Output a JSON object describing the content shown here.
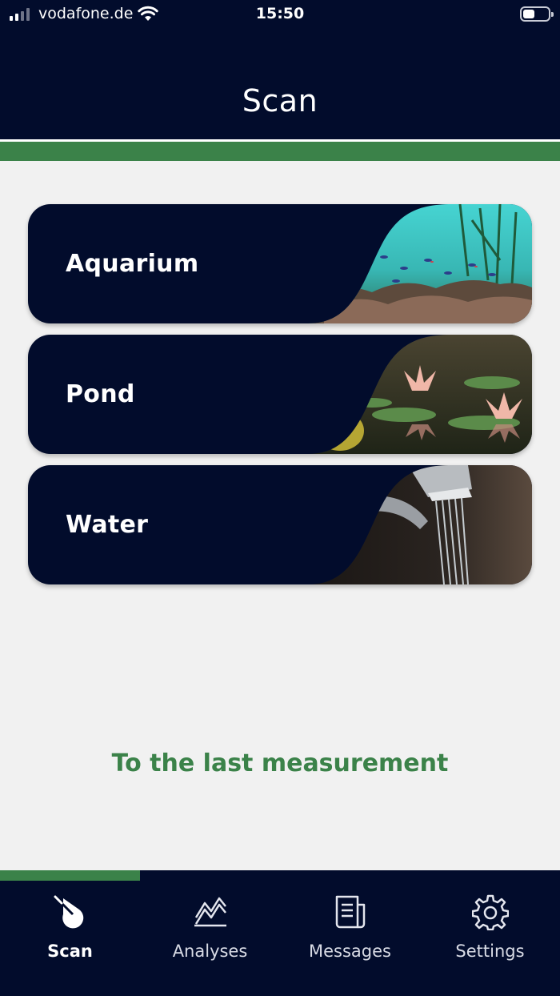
{
  "status_bar": {
    "carrier": "vodafone.de",
    "time": "15:50",
    "signal_bars": 4,
    "signal_bars_filled": 2,
    "battery_level": 0.45,
    "icons": [
      "signal-icon",
      "wifi-icon",
      "battery-icon"
    ]
  },
  "header": {
    "title": "Scan",
    "progress": 1.0
  },
  "colors": {
    "navy": "#020c2c",
    "accent_green": "#3b8249",
    "background": "#f1f1f1"
  },
  "cards": [
    {
      "label": "Aquarium",
      "image": "aquarium-photo"
    },
    {
      "label": "Pond",
      "image": "water-lily-photo"
    },
    {
      "label": "Water",
      "image": "faucet-photo"
    }
  ],
  "last_measurement_link": "To the last measurement",
  "tabbar": {
    "active_index": 0,
    "progress": 0.25,
    "tabs": [
      {
        "label": "Scan",
        "icon": "water-drop-icon"
      },
      {
        "label": "Analyses",
        "icon": "chart-icon"
      },
      {
        "label": "Messages",
        "icon": "newspaper-icon"
      },
      {
        "label": "Settings",
        "icon": "gear-icon"
      }
    ]
  }
}
